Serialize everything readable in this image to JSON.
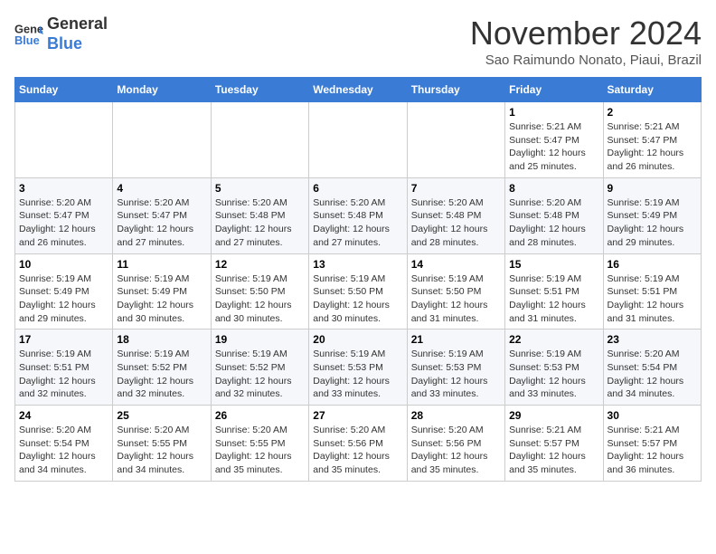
{
  "header": {
    "logo_general": "General",
    "logo_blue": "Blue",
    "month_title": "November 2024",
    "location": "Sao Raimundo Nonato, Piaui, Brazil"
  },
  "weekdays": [
    "Sunday",
    "Monday",
    "Tuesday",
    "Wednesday",
    "Thursday",
    "Friday",
    "Saturday"
  ],
  "weeks": [
    [
      {
        "day": "",
        "info": ""
      },
      {
        "day": "",
        "info": ""
      },
      {
        "day": "",
        "info": ""
      },
      {
        "day": "",
        "info": ""
      },
      {
        "day": "",
        "info": ""
      },
      {
        "day": "1",
        "info": "Sunrise: 5:21 AM\nSunset: 5:47 PM\nDaylight: 12 hours and 25 minutes."
      },
      {
        "day": "2",
        "info": "Sunrise: 5:21 AM\nSunset: 5:47 PM\nDaylight: 12 hours and 26 minutes."
      }
    ],
    [
      {
        "day": "3",
        "info": "Sunrise: 5:20 AM\nSunset: 5:47 PM\nDaylight: 12 hours and 26 minutes."
      },
      {
        "day": "4",
        "info": "Sunrise: 5:20 AM\nSunset: 5:47 PM\nDaylight: 12 hours and 27 minutes."
      },
      {
        "day": "5",
        "info": "Sunrise: 5:20 AM\nSunset: 5:48 PM\nDaylight: 12 hours and 27 minutes."
      },
      {
        "day": "6",
        "info": "Sunrise: 5:20 AM\nSunset: 5:48 PM\nDaylight: 12 hours and 27 minutes."
      },
      {
        "day": "7",
        "info": "Sunrise: 5:20 AM\nSunset: 5:48 PM\nDaylight: 12 hours and 28 minutes."
      },
      {
        "day": "8",
        "info": "Sunrise: 5:20 AM\nSunset: 5:48 PM\nDaylight: 12 hours and 28 minutes."
      },
      {
        "day": "9",
        "info": "Sunrise: 5:19 AM\nSunset: 5:49 PM\nDaylight: 12 hours and 29 minutes."
      }
    ],
    [
      {
        "day": "10",
        "info": "Sunrise: 5:19 AM\nSunset: 5:49 PM\nDaylight: 12 hours and 29 minutes."
      },
      {
        "day": "11",
        "info": "Sunrise: 5:19 AM\nSunset: 5:49 PM\nDaylight: 12 hours and 30 minutes."
      },
      {
        "day": "12",
        "info": "Sunrise: 5:19 AM\nSunset: 5:50 PM\nDaylight: 12 hours and 30 minutes."
      },
      {
        "day": "13",
        "info": "Sunrise: 5:19 AM\nSunset: 5:50 PM\nDaylight: 12 hours and 30 minutes."
      },
      {
        "day": "14",
        "info": "Sunrise: 5:19 AM\nSunset: 5:50 PM\nDaylight: 12 hours and 31 minutes."
      },
      {
        "day": "15",
        "info": "Sunrise: 5:19 AM\nSunset: 5:51 PM\nDaylight: 12 hours and 31 minutes."
      },
      {
        "day": "16",
        "info": "Sunrise: 5:19 AM\nSunset: 5:51 PM\nDaylight: 12 hours and 31 minutes."
      }
    ],
    [
      {
        "day": "17",
        "info": "Sunrise: 5:19 AM\nSunset: 5:51 PM\nDaylight: 12 hours and 32 minutes."
      },
      {
        "day": "18",
        "info": "Sunrise: 5:19 AM\nSunset: 5:52 PM\nDaylight: 12 hours and 32 minutes."
      },
      {
        "day": "19",
        "info": "Sunrise: 5:19 AM\nSunset: 5:52 PM\nDaylight: 12 hours and 32 minutes."
      },
      {
        "day": "20",
        "info": "Sunrise: 5:19 AM\nSunset: 5:53 PM\nDaylight: 12 hours and 33 minutes."
      },
      {
        "day": "21",
        "info": "Sunrise: 5:19 AM\nSunset: 5:53 PM\nDaylight: 12 hours and 33 minutes."
      },
      {
        "day": "22",
        "info": "Sunrise: 5:19 AM\nSunset: 5:53 PM\nDaylight: 12 hours and 33 minutes."
      },
      {
        "day": "23",
        "info": "Sunrise: 5:20 AM\nSunset: 5:54 PM\nDaylight: 12 hours and 34 minutes."
      }
    ],
    [
      {
        "day": "24",
        "info": "Sunrise: 5:20 AM\nSunset: 5:54 PM\nDaylight: 12 hours and 34 minutes."
      },
      {
        "day": "25",
        "info": "Sunrise: 5:20 AM\nSunset: 5:55 PM\nDaylight: 12 hours and 34 minutes."
      },
      {
        "day": "26",
        "info": "Sunrise: 5:20 AM\nSunset: 5:55 PM\nDaylight: 12 hours and 35 minutes."
      },
      {
        "day": "27",
        "info": "Sunrise: 5:20 AM\nSunset: 5:56 PM\nDaylight: 12 hours and 35 minutes."
      },
      {
        "day": "28",
        "info": "Sunrise: 5:20 AM\nSunset: 5:56 PM\nDaylight: 12 hours and 35 minutes."
      },
      {
        "day": "29",
        "info": "Sunrise: 5:21 AM\nSunset: 5:57 PM\nDaylight: 12 hours and 35 minutes."
      },
      {
        "day": "30",
        "info": "Sunrise: 5:21 AM\nSunset: 5:57 PM\nDaylight: 12 hours and 36 minutes."
      }
    ]
  ]
}
